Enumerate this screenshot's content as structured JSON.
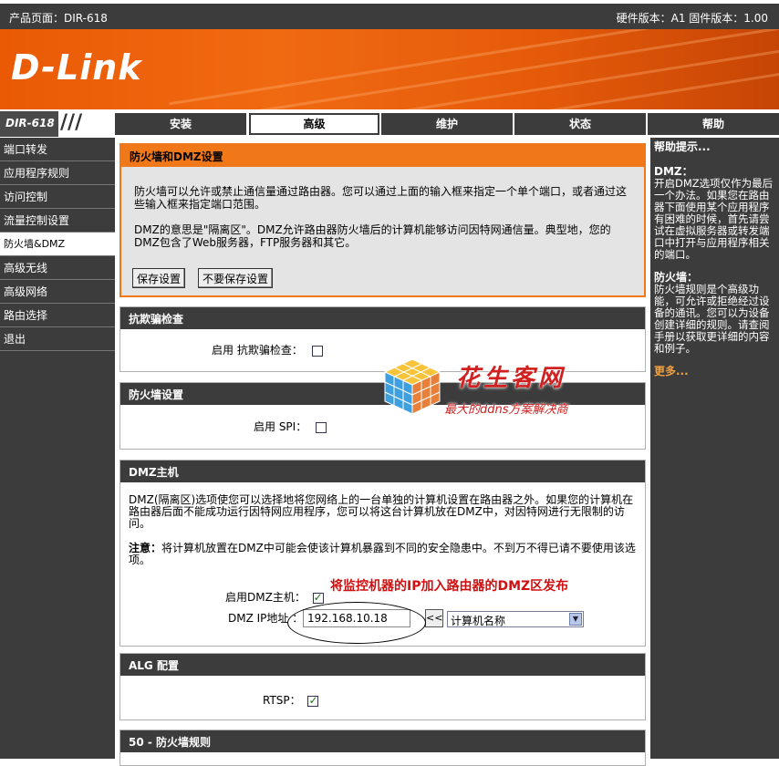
{
  "topbar": {
    "product": "产品页面：DIR-618",
    "versions": "硬件版本：A1   固件版本：1.00"
  },
  "brand": {
    "logo": "D-Link",
    "model": "DIR-618"
  },
  "tabs": [
    {
      "label": "安装",
      "active": false
    },
    {
      "label": "高级",
      "active": true
    },
    {
      "label": "维护",
      "active": false
    },
    {
      "label": "状态",
      "active": false
    },
    {
      "label": "帮助",
      "active": false
    }
  ],
  "sidebar": {
    "items": [
      {
        "label": "端口转发"
      },
      {
        "label": "应用程序规则"
      },
      {
        "label": "访问控制"
      },
      {
        "label": "流量控制设置"
      },
      {
        "label": "防火墙&DMZ"
      },
      {
        "label": "高级无线"
      },
      {
        "label": "高级网络"
      },
      {
        "label": "路由选择"
      },
      {
        "label": "退出"
      }
    ]
  },
  "intro": {
    "title": "防火墙和DMZ设置",
    "p1": "防火墙可以允许或禁止通信量通过路由器。您可以通过上面的输入框来指定一个单个端口，或者通过这些输入框来指定端口范围。",
    "p2": "DMZ的意思是\"隔离区\"。DMZ允许路由器防火墙后的计算机能够访问因特网通信量。典型地，您的DMZ包含了Web服务器，FTP服务器和其它。",
    "save": "保存设置",
    "nosave": "不要保存设置"
  },
  "antispoof": {
    "title": "抗欺骗检查",
    "label": "启用 抗欺骗检查：",
    "checked": false
  },
  "firewall": {
    "title": "防火墙设置",
    "label": "启用 SPI：",
    "checked": false
  },
  "dmz": {
    "title": "DMZ主机",
    "desc": "DMZ(隔离区)选项使您可以选择地将您网络上的一台单独的计算机设置在路由器之外。如果您的计算机在路由器后面不能成功运行因特网应用程序，您可以将这台计算机放在DMZ中，对因特网进行无限制的访问。",
    "note_label": "注意：",
    "note": "将计算机放置在DMZ中可能会使该计算机暴露到不同的安全隐患中。不到万不得已请不要使用该选项。",
    "enable_label": "启用DMZ主机：",
    "enable_checked": true,
    "ip_label": "DMZ IP地址 ：",
    "ip_value": "192.168.10.18",
    "arrow_btn": "<<",
    "computer_select": "计算机名称"
  },
  "alg": {
    "title": "ALG 配置",
    "rtsp_label": "RTSP：",
    "rtsp_checked": true
  },
  "rules": {
    "title": "50 - 防火墙规则"
  },
  "annotation": "将监控机器的IP加入路由器的DMZ区发布",
  "watermark": {
    "name": "花生客网",
    "slogan": "最大的ddns方案解决商"
  },
  "help": {
    "title": "帮助提示...",
    "dmz_title": "DMZ：",
    "dmz_text": "开启DMZ选项仅作为最后一个办法。如果您在路由器下面使用某个应用程序有困难的时候，首先请尝试在虚拟服务器或转发端口中打开与应用程序相关的端口。",
    "fw_title": "防火墙：",
    "fw_text": "防火墙规则是个高级功能，可允许或拒绝经过设备的通讯。您可以为设备创建详细的规则。请查阅手册以获取更详细的内容和例子。",
    "more": "更多..."
  }
}
